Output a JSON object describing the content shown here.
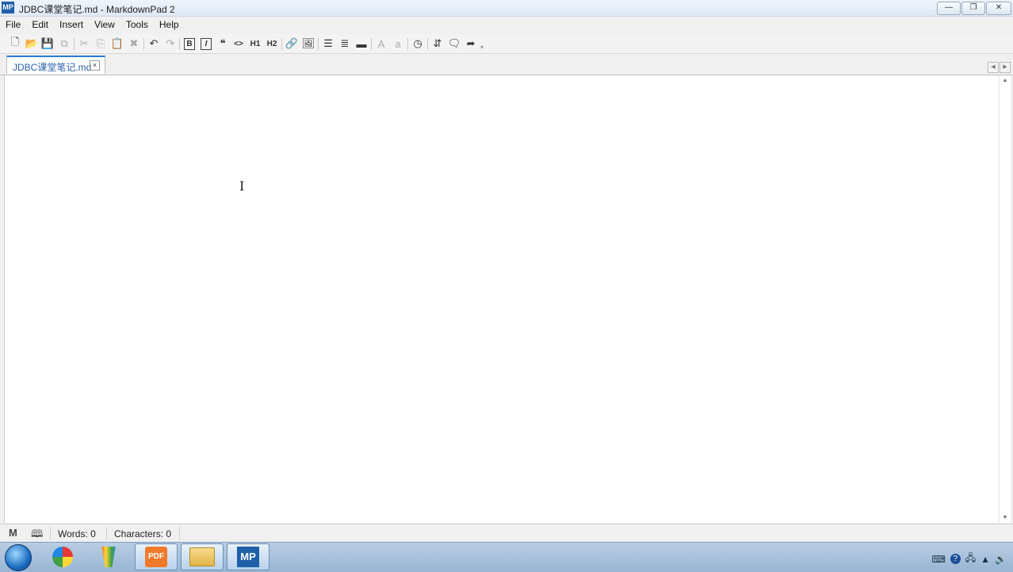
{
  "window": {
    "title": "JDBC课堂笔记.md - MarkdownPad 2",
    "app_icon_text": "MP"
  },
  "window_buttons": {
    "minimize": "—",
    "restore": "❐",
    "close": "✕"
  },
  "menu": [
    "File",
    "Edit",
    "Insert",
    "View",
    "Tools",
    "Help"
  ],
  "toolbar": {
    "bold": "B",
    "italic": "I",
    "quote": "❝",
    "code": "<>",
    "h1": "H1",
    "h2": "H2",
    "font_large": "A",
    "font_small": "a"
  },
  "tab": {
    "label": "JDBC课堂笔记.md",
    "close": "×"
  },
  "editor": {
    "content": ""
  },
  "status": {
    "words": "Words: 0",
    "characters": "Characters: 0"
  },
  "taskbar": {
    "markdownpad_label": "MP",
    "pdf_label": "PDF"
  }
}
